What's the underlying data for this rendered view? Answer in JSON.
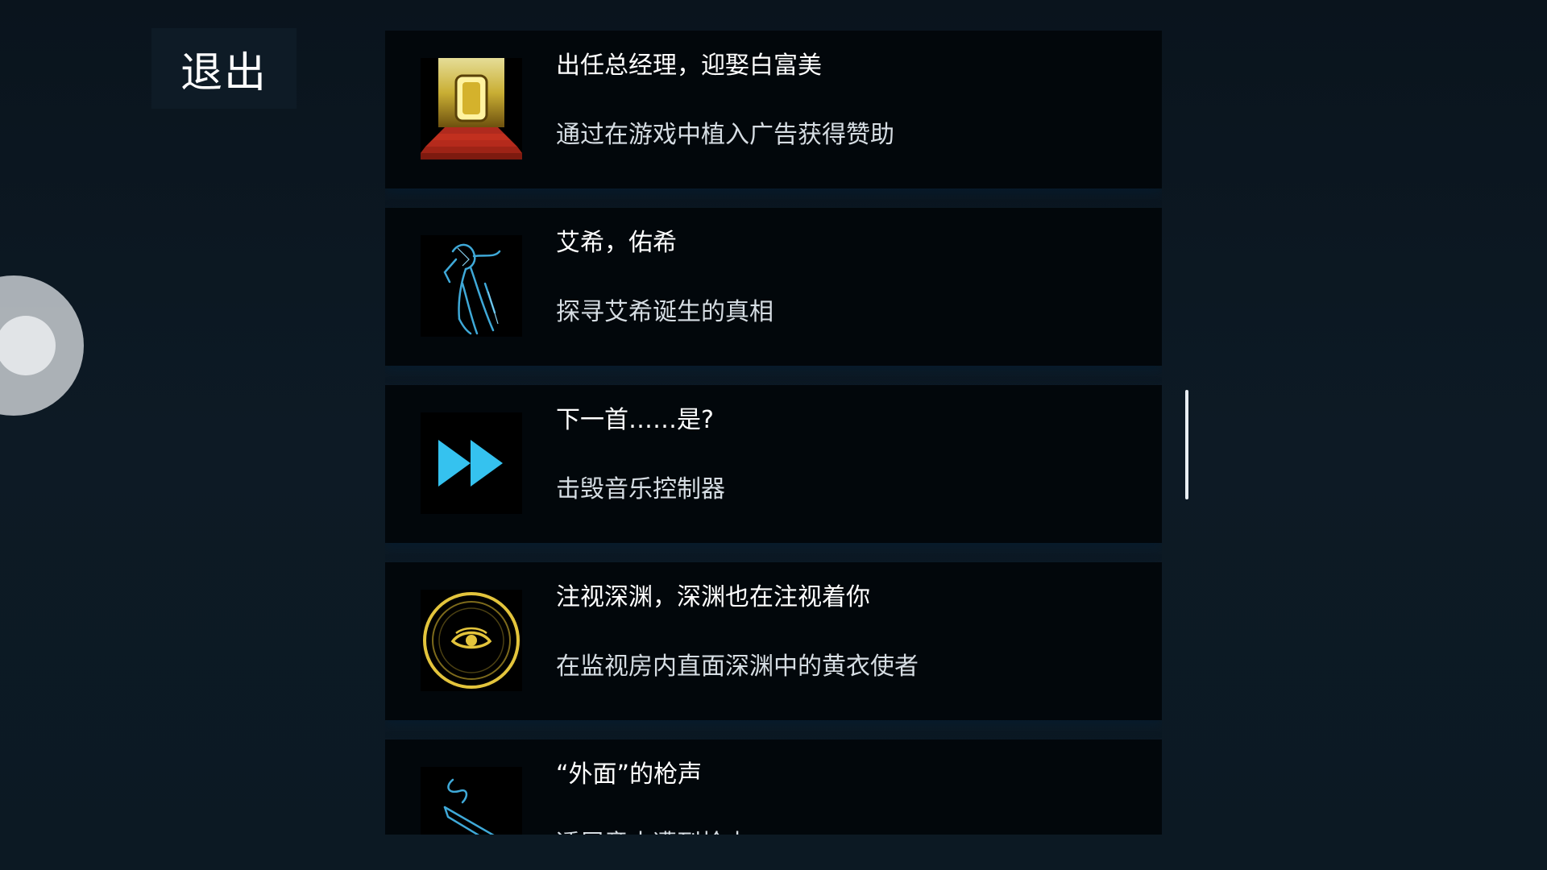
{
  "exit_button": {
    "label": "退出",
    "icon": "exit-text-button"
  },
  "assist_ball": {
    "icon": "floating-assistive-touch-icon"
  },
  "achievements": [
    {
      "title": "出任总经理，迎娶白富美",
      "description": "通过在游戏中植入广告获得赞助",
      "icon": "golden-doorway-icon"
    },
    {
      "title": "艾希，佑希",
      "description": "探寻艾希诞生的真相",
      "icon": "blue-figure-sketch-icon"
    },
    {
      "title": "下一首……是?",
      "description": "击毁音乐控制器",
      "icon": "fast-forward-icon"
    },
    {
      "title": "注视深渊，深渊也在注视着你",
      "description": "在监视房内直面深渊中的黄衣使者",
      "icon": "eye-circle-icon"
    },
    {
      "title": "“外面”的枪声",
      "description": "透层意内遭到枪击",
      "icon": "blue-pistol-icon"
    }
  ],
  "colors": {
    "background": "#0c1822",
    "card": "#02070b",
    "accent_blue": "#2bb8e6",
    "accent_gold": "#e0c23a"
  }
}
